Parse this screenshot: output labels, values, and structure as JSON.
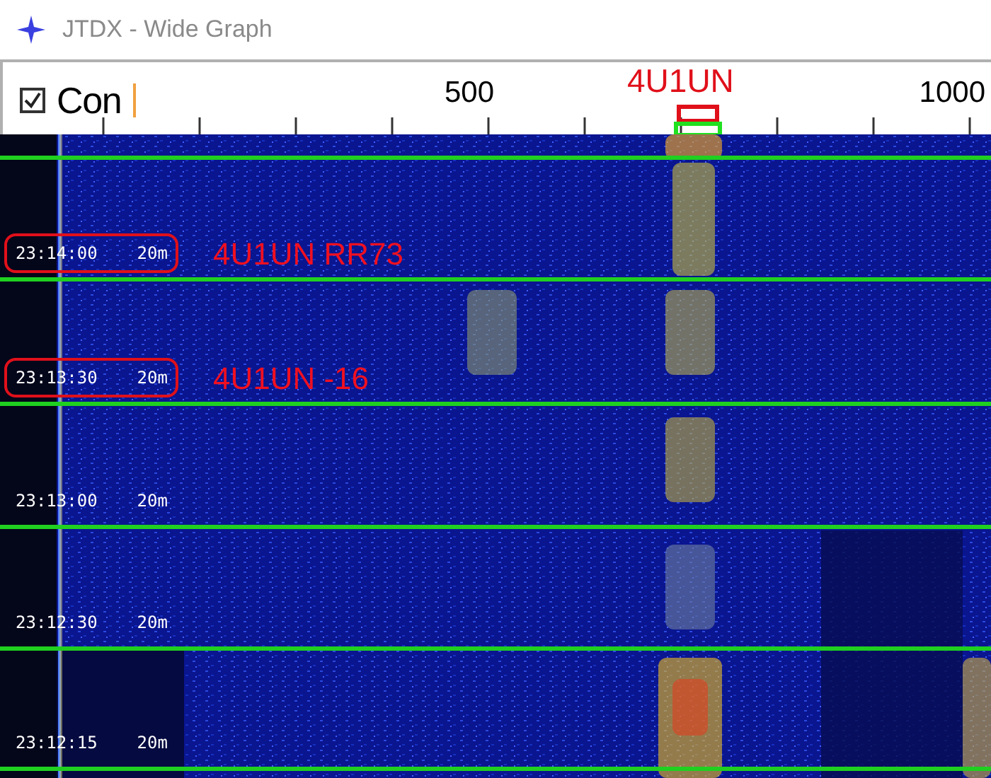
{
  "window": {
    "title": "JTDX - Wide Graph"
  },
  "control": {
    "label": "Con",
    "checked": true
  },
  "scale": {
    "labels": [
      "500",
      "1000"
    ]
  },
  "marker_label": "4U1UN",
  "rows": [
    {
      "time": "23:14:00",
      "band": "20m",
      "boxed": true,
      "note": "4U1UN RR73"
    },
    {
      "time": "23:13:30",
      "band": "20m",
      "boxed": true,
      "note": "4U1UN -16"
    },
    {
      "time": "23:13:00",
      "band": "20m",
      "boxed": false
    },
    {
      "time": "23:12:30",
      "band": "20m",
      "boxed": false
    },
    {
      "time": "23:12:15",
      "band": "20m",
      "boxed": false
    }
  ]
}
